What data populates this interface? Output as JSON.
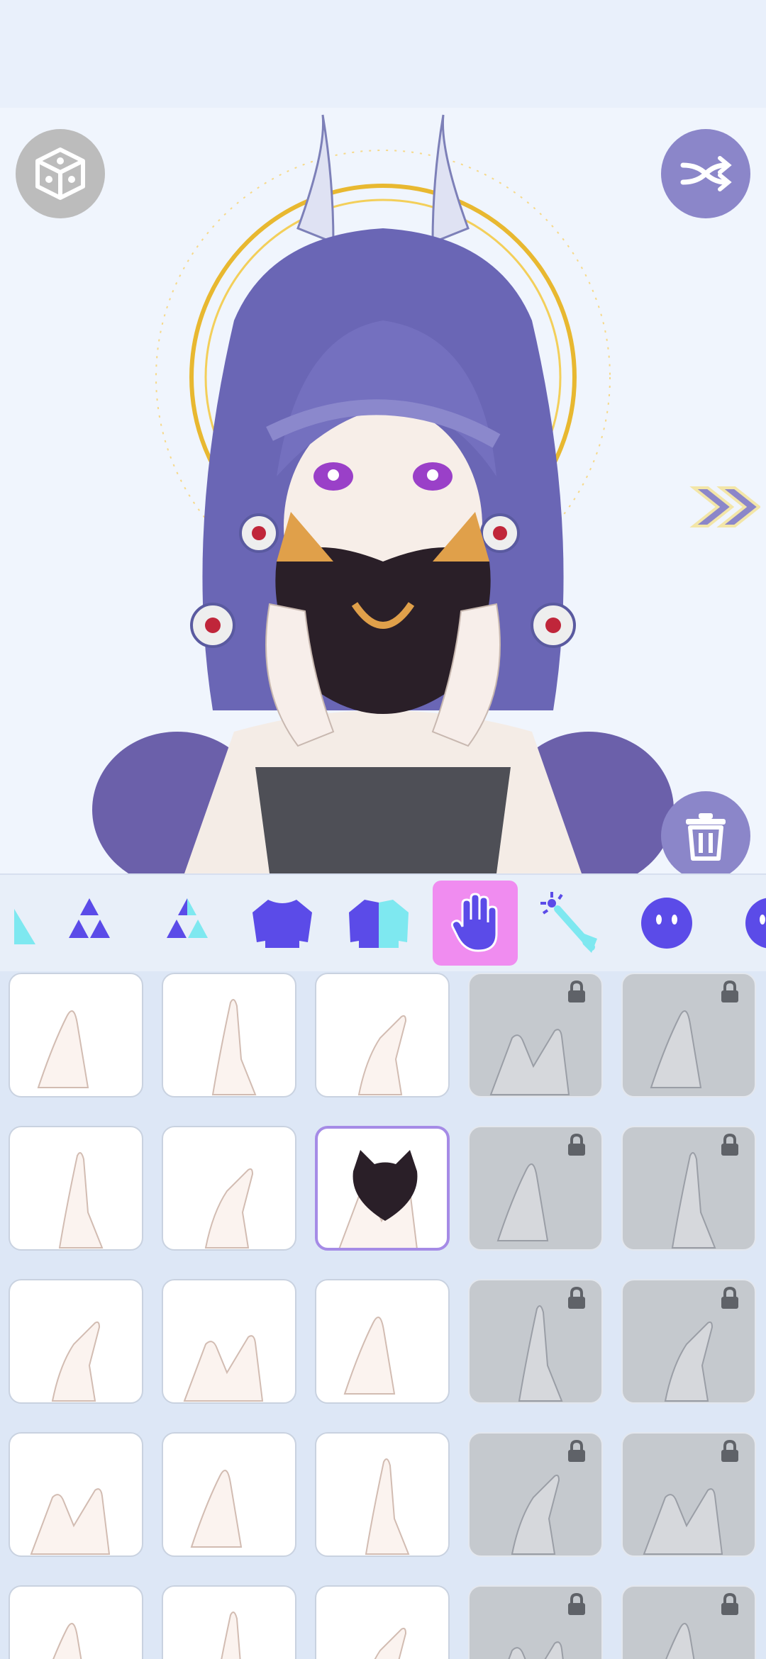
{
  "app": {
    "buttons": {
      "random": "dice-icon",
      "shuffle": "shuffle-icon",
      "next": "double-chevron-icon",
      "delete": "trash-icon"
    }
  },
  "categories": [
    {
      "icon": "partial-shape-icon",
      "selected": false
    },
    {
      "icon": "triangles-icon",
      "selected": false
    },
    {
      "icon": "triangles-color-icon",
      "selected": false
    },
    {
      "icon": "sweater-icon",
      "selected": false
    },
    {
      "icon": "jacket-icon",
      "selected": false
    },
    {
      "icon": "hand-icon",
      "selected": true
    },
    {
      "icon": "magic-wand-icon",
      "selected": false
    },
    {
      "icon": "face-icon",
      "selected": false
    },
    {
      "icon": "partial-face-icon",
      "selected": false
    }
  ],
  "items": {
    "rows": 5,
    "cols": 5,
    "selected_row": 1,
    "selected_col": 2,
    "locked_columns": [
      3,
      4
    ]
  },
  "colors": {
    "accent": "#8b86c9",
    "selected_tab": "#f08cf0",
    "icon_purple": "#5b4be8",
    "icon_cyan": "#7ee8f0",
    "hair": "#6a66b5"
  }
}
